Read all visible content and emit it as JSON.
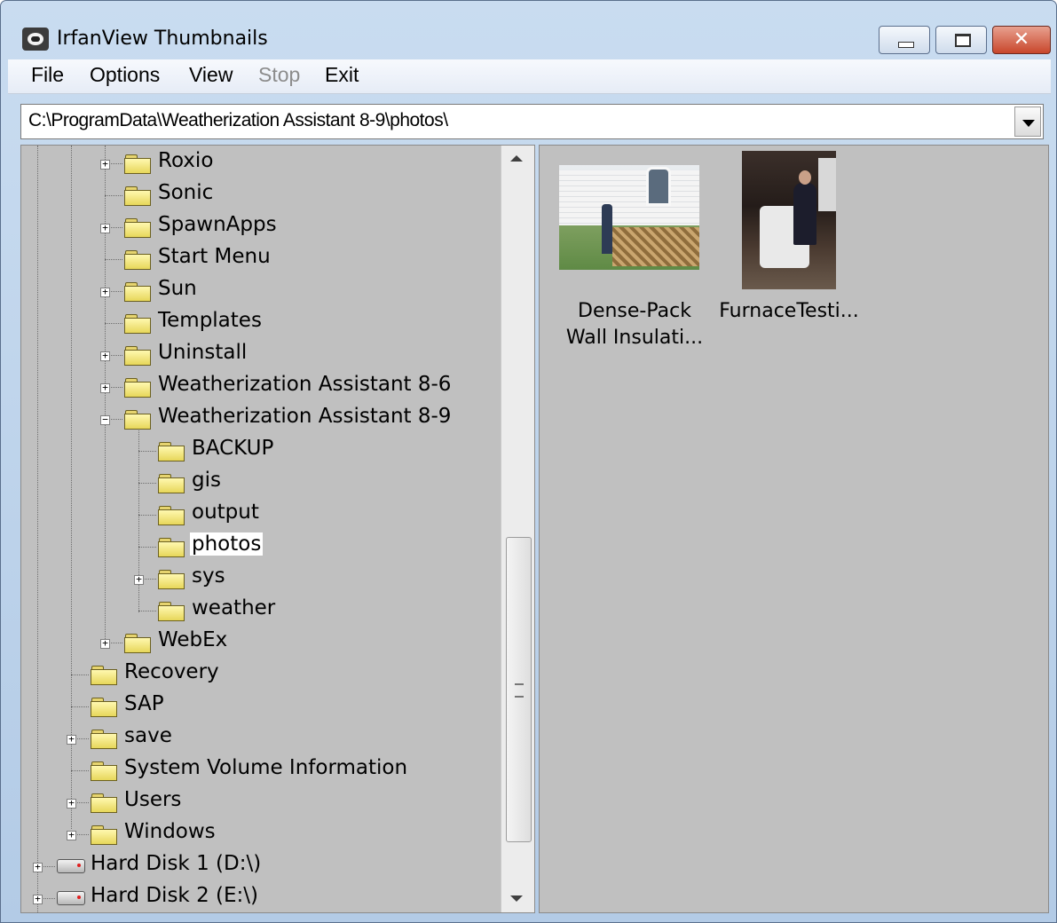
{
  "window": {
    "title": "IrfanView Thumbnails"
  },
  "menu": [
    {
      "label": "File",
      "enabled": true
    },
    {
      "label": "Options",
      "enabled": true
    },
    {
      "label": "View",
      "enabled": true
    },
    {
      "label": "Stop",
      "enabled": false
    },
    {
      "label": "Exit",
      "enabled": true
    }
  ],
  "address": {
    "path": "C:\\ProgramData\\Weatherization Assistant 8-9\\photos\\"
  },
  "tree": [
    {
      "label": "Roxio",
      "expander": "+",
      "icon": "folder-icon"
    },
    {
      "label": "Sonic",
      "expander": "",
      "icon": "folder-icon"
    },
    {
      "label": "SpawnApps",
      "expander": "+",
      "icon": "folder-icon"
    },
    {
      "label": "Start Menu",
      "expander": "",
      "icon": "folder-icon"
    },
    {
      "label": "Sun",
      "expander": "+",
      "icon": "folder-icon"
    },
    {
      "label": "Templates",
      "expander": "",
      "icon": "folder-icon"
    },
    {
      "label": "Uninstall",
      "expander": "+",
      "icon": "folder-icon"
    },
    {
      "label": "Weatherization Assistant 8-6",
      "expander": "+",
      "icon": "folder-icon"
    },
    {
      "label": "Weatherization Assistant 8-9",
      "expander": "-",
      "icon": "folder-icon"
    },
    {
      "label": "BACKUP",
      "expander": "",
      "icon": "folder-icon"
    },
    {
      "label": "gis",
      "expander": "",
      "icon": "folder-icon"
    },
    {
      "label": "output",
      "expander": "",
      "icon": "folder-icon"
    },
    {
      "label": "photos",
      "expander": "",
      "icon": "open-folder-icon",
      "selected": true
    },
    {
      "label": "sys",
      "expander": "+",
      "icon": "folder-icon"
    },
    {
      "label": "weather",
      "expander": "",
      "icon": "folder-icon"
    },
    {
      "label": "WebEx",
      "expander": "+",
      "icon": "folder-icon"
    },
    {
      "label": "Recovery",
      "expander": "",
      "icon": "folder-icon"
    },
    {
      "label": "SAP",
      "expander": "",
      "icon": "folder-icon"
    },
    {
      "label": "save",
      "expander": "+",
      "icon": "folder-icon"
    },
    {
      "label": "System Volume Information",
      "expander": "",
      "icon": "folder-icon"
    },
    {
      "label": "Users",
      "expander": "+",
      "icon": "folder-icon"
    },
    {
      "label": "Windows",
      "expander": "+",
      "icon": "folder-icon"
    },
    {
      "label": "Hard Disk 1 (D:\\)",
      "expander": "+",
      "icon": "drive-icon"
    },
    {
      "label": "Hard Disk 2 (E:\\)",
      "expander": "+",
      "icon": "drive-icon"
    }
  ],
  "thumbnails": [
    {
      "caption_line1": "Dense-Pack",
      "caption_line2": "Wall Insulati..."
    },
    {
      "caption_line1": "FurnaceTesti...",
      "caption_line2": ""
    }
  ]
}
